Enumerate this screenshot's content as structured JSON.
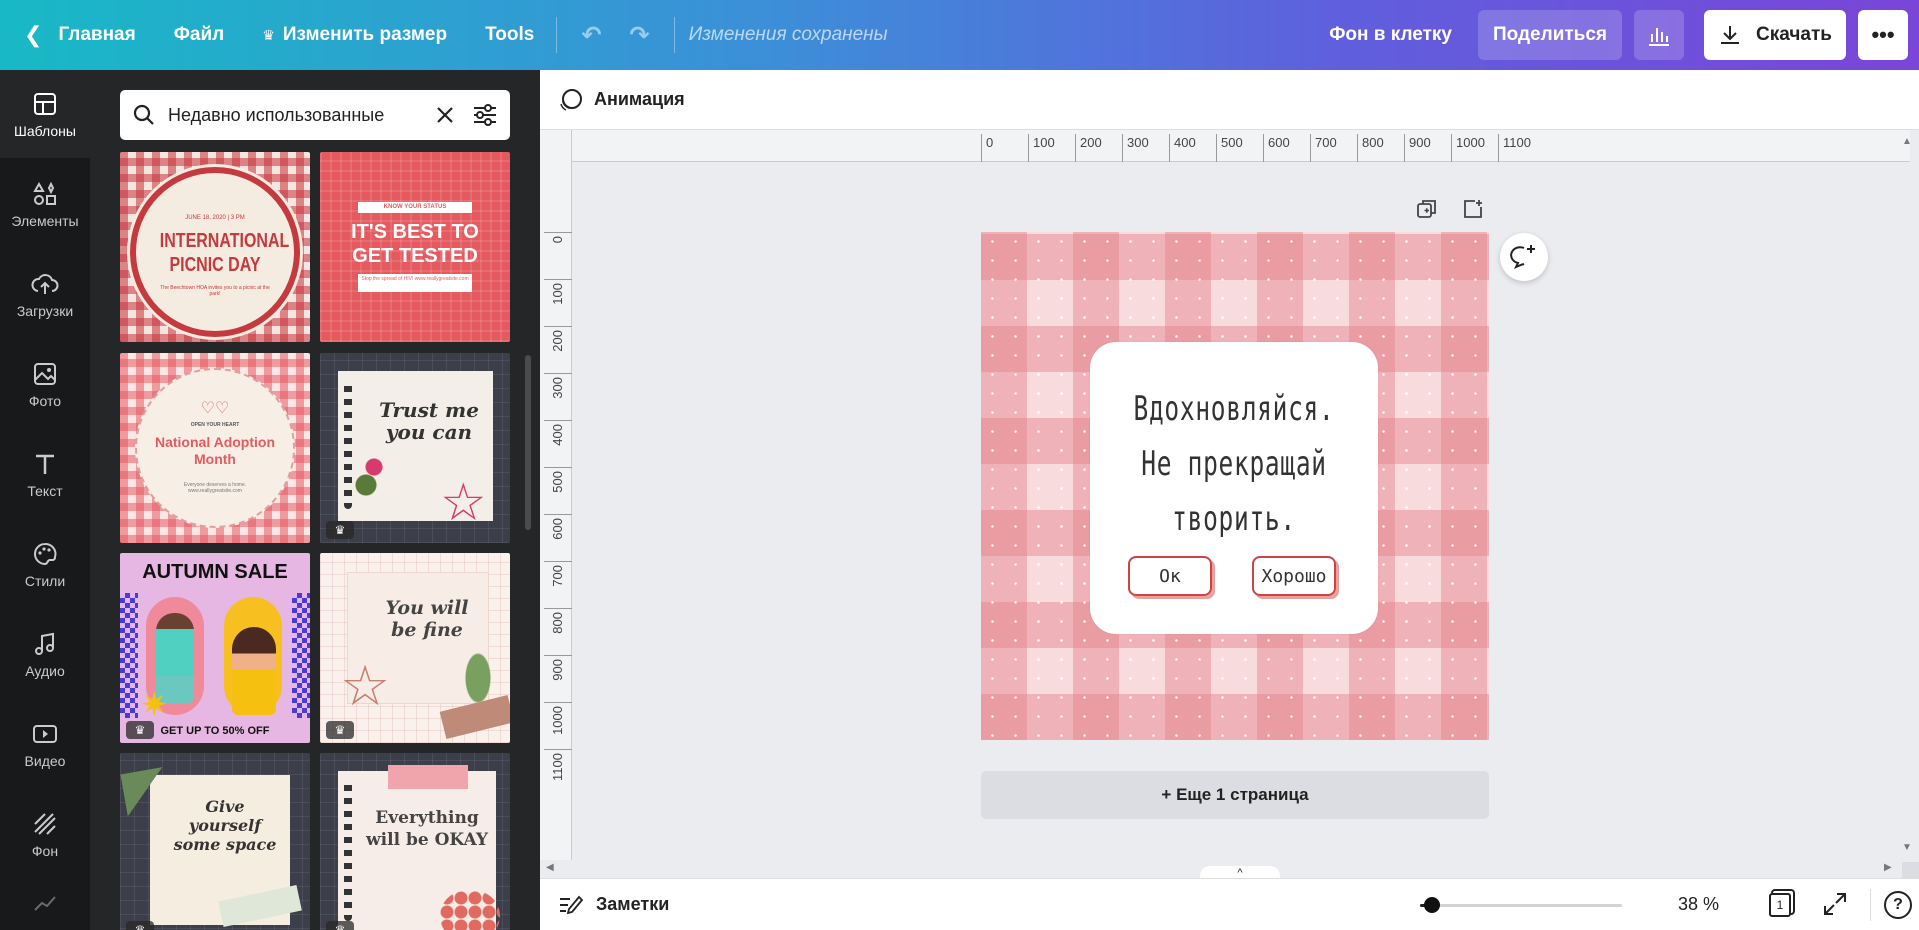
{
  "topbar": {
    "home_label": "Главная",
    "file_label": "Файл",
    "resize_label": "Изменить размер",
    "tools_label": "Tools",
    "saved_status": "Изменения сохранены",
    "design_title": "Фон в клетку",
    "share_label": "Поделиться",
    "download_label": "Скачать"
  },
  "rail": {
    "items": [
      {
        "label": "Шаблоны"
      },
      {
        "label": "Элементы"
      },
      {
        "label": "Загрузки"
      },
      {
        "label": "Фото"
      },
      {
        "label": "Текст"
      },
      {
        "label": "Стили"
      },
      {
        "label": "Аудио"
      },
      {
        "label": "Видео"
      },
      {
        "label": "Фон"
      }
    ]
  },
  "panel": {
    "search_value": "Недавно использованные",
    "templates": [
      {
        "date": "JUNE 18, 2020 | 3 PM",
        "title": "INTERNATIONAL PICNIC DAY",
        "body": "The Beechtown HOA invites you to a picnic at the park!"
      },
      {
        "small": "KNOW YOUR STATUS",
        "title": "IT'S BEST TO GET TESTED",
        "body": "Stop the spread of HIV! www.reallygreatsite.com"
      },
      {
        "small": "OPEN YOUR HEART",
        "title": "National Adoption Month",
        "body": "Everyone deserves a home. www.reallygreatsite.com"
      },
      {
        "title": "Trust me you can"
      },
      {
        "title": "AUTUMN SALE",
        "body": "GET UP TO 50% OFF"
      },
      {
        "title": "You will be fine"
      },
      {
        "title": "Give yourself some space"
      },
      {
        "title": "Everything will be OKAY"
      }
    ]
  },
  "subbar": {
    "animation_label": "Анимация"
  },
  "ruler": {
    "top_ticks": [
      "0",
      "100",
      "200",
      "300",
      "400",
      "500",
      "600",
      "700",
      "800",
      "900",
      "1000",
      "1100"
    ],
    "left_ticks": [
      "0",
      "100",
      "200",
      "300",
      "400",
      "500",
      "600",
      "700",
      "800",
      "900",
      "1000",
      "1100"
    ]
  },
  "canvas": {
    "line1": "Вдохновляйся.",
    "line2": "Не прекращай",
    "line3": "творить.",
    "ok_label": "Ок",
    "good_label": "Хорошо"
  },
  "add_page_label": "+ Еще 1 страница",
  "bottombar": {
    "notes_label": "Заметки",
    "zoom_value": "38 %",
    "zoom_level": 0.38,
    "page_count": "1"
  },
  "colors": {
    "pink_light": "#f6d4d6",
    "pink_mid": "#efb4b8",
    "pink_dark": "#e69aa0",
    "panel_bg": "#252627",
    "rail_bg": "#18191b"
  }
}
